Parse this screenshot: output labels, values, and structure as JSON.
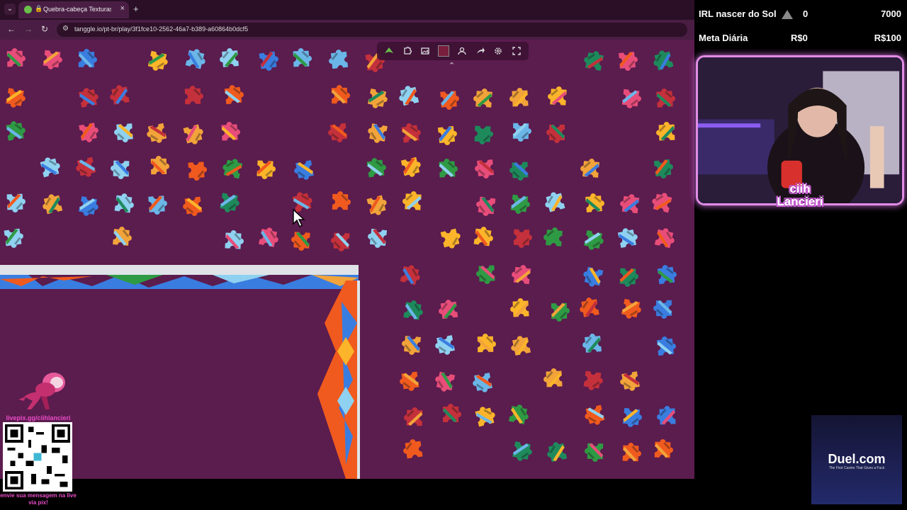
{
  "browser": {
    "tab_title": "Quebra-cabeça Texturas e P",
    "tab_close": "×",
    "new_tab": "+",
    "tab_menu": "⌄",
    "url": "tanggle.io/pt-br/play/3f1fce10-2562-46a7-b389-a60864b0dcf5",
    "back": "←",
    "forward": "→",
    "reload": "↻"
  },
  "toolbar": {
    "icons": [
      "piece-filter-icon",
      "puzzle-edge-icon",
      "preview-image-icon",
      "background-color-icon",
      "players-icon",
      "share-icon",
      "settings-icon",
      "fullscreen-icon"
    ],
    "collapse": "⌃",
    "background_color": "#7a1e3e"
  },
  "overlay": {
    "irl_label": "IRL nascer do Sol",
    "irl_count": "0",
    "irl_goal": "7000",
    "meta_label": "Meta Diária",
    "meta_current": "R$0",
    "meta_goal": "R$100",
    "streamer_name_line1": "ciih",
    "streamer_name_line2": "Lancieri",
    "pix_link": "livepix.gg/ciihlancieri",
    "pix_note": "envie sua mensagem na live via pix!",
    "ad_title": "Duel.com",
    "ad_tagline": "The First Casino That Gives a Fuck"
  },
  "colors": {
    "board_bg": "#5b1c4e",
    "accent_pink": "#e94cc8",
    "webcam_border": "#e18ce6",
    "piece_palette": [
      "#f05a1e",
      "#2f9a44",
      "#3a7de0",
      "#8fd1f0",
      "#f2a33a",
      "#e84d7a",
      "#6bb6e8",
      "#1e8a5c",
      "#c4303b",
      "#fcb42a"
    ]
  }
}
